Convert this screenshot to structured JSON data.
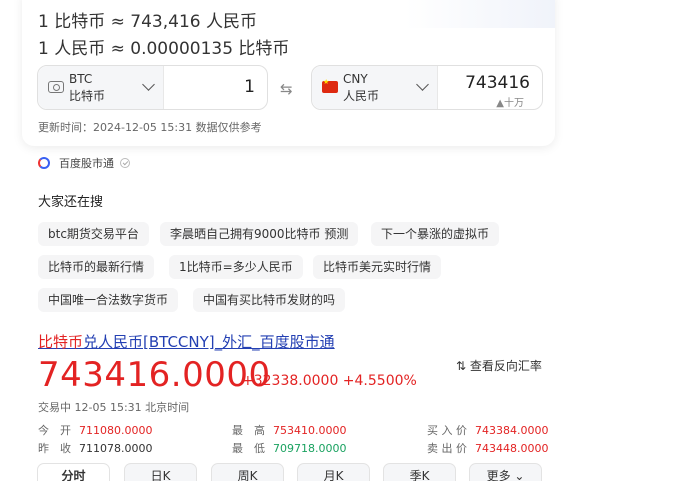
{
  "converter": {
    "rate_line_1": "1 比特币 ≈ 743,416 人民币",
    "rate_line_2": "1 人民币 ≈ 0.00000135 比特币",
    "from": {
      "code": "BTC",
      "name": "比特币",
      "amount": "1",
      "icon": "bitcoin-note-icon"
    },
    "to": {
      "code": "CNY",
      "name": "人民币",
      "amount": "743416",
      "unit": "▲十万",
      "icon": "china-flag-icon"
    },
    "swap_icon": "⇆",
    "update_time": "更新时间：2024-12-05 15:31 数据仅供参考"
  },
  "source": {
    "name": "百度股市通"
  },
  "also_search": {
    "title": "大家还在搜",
    "chips": [
      "btc期货交易平台",
      "李晨晒自己拥有9000比特币 预测",
      "下一个暴涨的虚拟币",
      "比特币的最新行情",
      "1比特币=多少人民币",
      "比特币美元实时行情",
      "中国唯一合法数字货币",
      "中国有买比特币发财的吗"
    ]
  },
  "result": {
    "title_highlight": "比特币",
    "title_rest": "兑人民币[BTCCNY]_外汇_百度股市通",
    "reverse_rate": "⇅ 查看反向汇率",
    "price": "743416.0000",
    "change": "+32338.0000  +4.5500%",
    "status": "交易中  12-05 15:31  北京时间",
    "quotes": {
      "open_label": "今　开",
      "open_value": "711080.0000",
      "prev_close_label": "昨　收",
      "prev_close_value": "711078.0000",
      "high_label": "最　高",
      "high_value": "753410.0000",
      "low_label": "最　低",
      "low_value": "709718.0000",
      "bid_label": "买 入 价",
      "bid_value": "743384.0000",
      "ask_label": "卖 出 价",
      "ask_value": "743448.0000"
    },
    "tabs": [
      "分时",
      "日K",
      "周K",
      "月K",
      "季K",
      "更多 ⌄"
    ]
  },
  "colors": {
    "up": "#e32323",
    "down": "#1aa260",
    "link": "#2440b3"
  }
}
